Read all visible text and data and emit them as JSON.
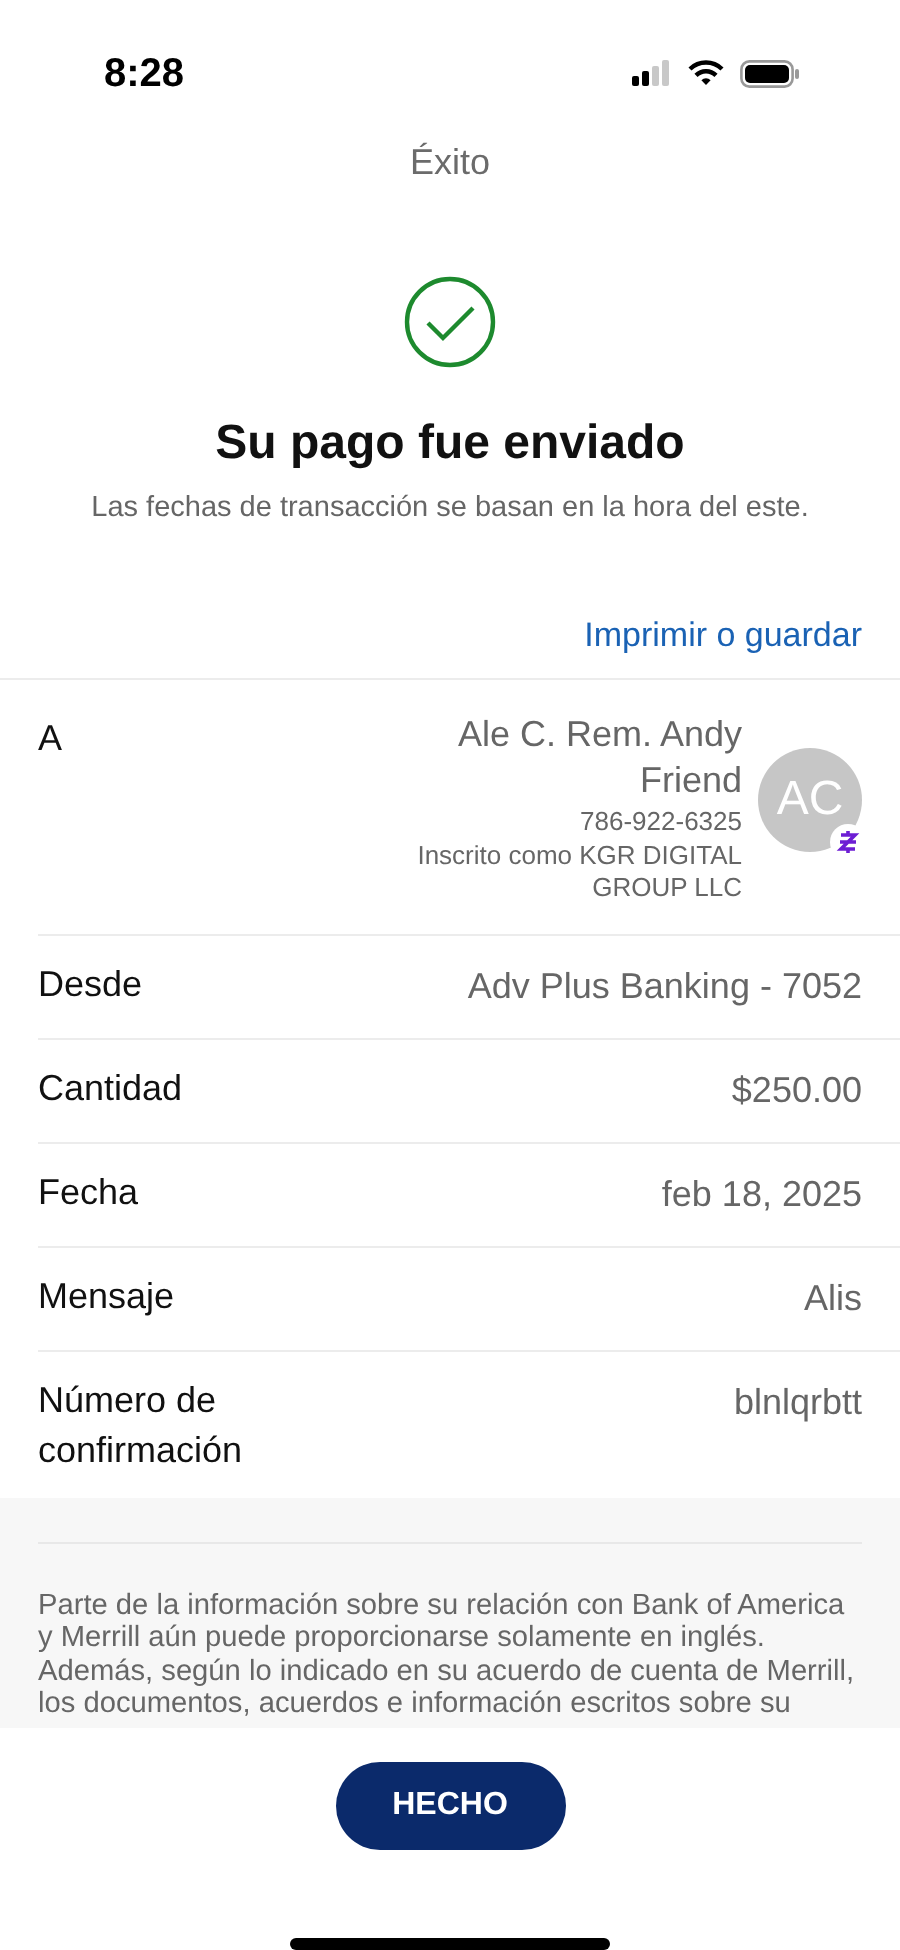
{
  "status_bar": {
    "time": "8:28"
  },
  "header": {
    "title": "Éxito"
  },
  "confirmation": {
    "heading": "Su pago fue enviado",
    "note": "Las fechas de transacción se basan en la hora del este."
  },
  "print_link": "Imprimir o guardar",
  "details": [
    {
      "kind": "recipient",
      "label": "A",
      "name": "Ale C. Rem. Andy Friend",
      "phone": "786-922-6325",
      "enrolled": "Inscrito como KGR DIGITAL GROUP LLC",
      "initials": "AC"
    },
    {
      "kind": "simple",
      "label": "Desde",
      "value": "Adv Plus Banking - 7052"
    },
    {
      "kind": "simple",
      "label": "Cantidad",
      "value": "$250.00"
    },
    {
      "kind": "simple",
      "label": "Fecha",
      "value": "feb 18, 2025"
    },
    {
      "kind": "simple",
      "label": "Mensaje",
      "value": "Alis"
    },
    {
      "kind": "simple",
      "label": "Número de confirmación",
      "value": "blnlqrbtt"
    }
  ],
  "disclaimer": [
    "Parte de la información sobre su relación con Bank of America",
    "y Merrill aún puede proporcionarse solamente en inglés.",
    "Además, según lo indicado en su acuerdo de cuenta de Merrill,",
    "los documentos, acuerdos e información escritos sobre su"
  ],
  "done_button": "HECHO"
}
